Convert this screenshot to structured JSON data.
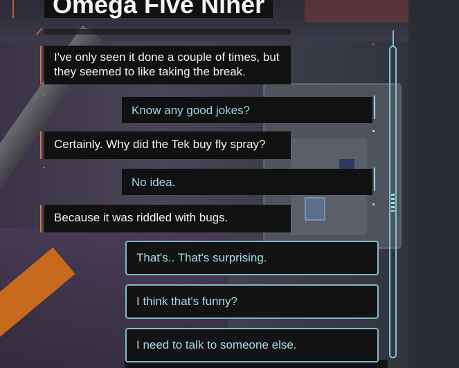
{
  "title": "Omega Five Niner",
  "dialogue": {
    "npc_1": "I've only seen it done a couple of times, but they seemed to like taking the break.",
    "player_1": "Know any good jokes?",
    "npc_2": "Certainly. Why did the Tek buy fly spray?",
    "player_2": "No idea.",
    "npc_3": "Because it was riddled with bugs."
  },
  "choices": [
    "That's.. That's surprising.",
    "I think that's funny?",
    "I need to talk to someone else."
  ],
  "colors": {
    "npc_accent": "#d8733a",
    "player_text": "#9fd6e2",
    "choice_border": "#7fb9c6"
  }
}
